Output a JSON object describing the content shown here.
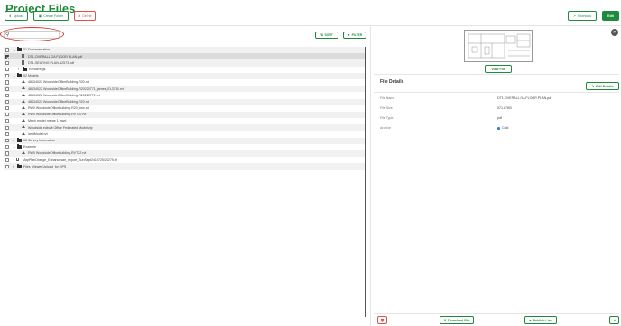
{
  "header": {
    "title": "Project Files",
    "upload_label": "Upload",
    "create_folder_label": "Create Folder",
    "delete_label": "Delete",
    "shortcuts_label": "Shortcuts",
    "edit_label": "Edit"
  },
  "search": {
    "placeholder": "",
    "value": ""
  },
  "toolbar": {
    "sort_label": "SORT",
    "filter_label": "FILTER"
  },
  "tree": [
    {
      "label": "01 Documentation",
      "type": "folder",
      "level": 0,
      "expanded": true,
      "checked": false
    },
    {
      "label": "DT1-OVERALL GA FLOOR PLAN.pdf",
      "type": "file",
      "level": 1,
      "checked": true,
      "selected": true
    },
    {
      "label": "DT1-SEATING PLAN-12573.pdf",
      "type": "file",
      "level": 1,
      "checked": false
    },
    {
      "label": "Renderings",
      "type": "folder",
      "level": 1,
      "expanded": false,
      "checked": false
    },
    {
      "label": "02 Models",
      "type": "folder",
      "level": 0,
      "expanded": true,
      "checked": false
    },
    {
      "label": "48634022 WoodsideOfficeBuilding-R20.rvt",
      "type": "model",
      "level": 1,
      "checked": false
    },
    {
      "label": "48634022 WoodsideOfficeBuilding-R20220771_james_EL3740.rvt",
      "type": "model",
      "level": 1,
      "checked": false
    },
    {
      "label": "48634022 WoodsideOfficeBuilding-R20220771.rvt",
      "type": "model",
      "level": 1,
      "checked": false
    },
    {
      "label": "48634022 WoodsideOfficeBuilding-R20.rvt",
      "type": "model",
      "level": 1,
      "checked": false
    },
    {
      "label": "RW0 WoodsideOfficeBuilding-R20_ano.rvt",
      "type": "model",
      "level": 1,
      "checked": false
    },
    {
      "label": "RW0 WoodsideOfficeBuilding-RVT20.rvt",
      "type": "model",
      "level": 1,
      "checked": false
    },
    {
      "label": "Mesh model merge 1 .nwd",
      "type": "model",
      "level": 1,
      "checked": false
    },
    {
      "label": "Woodside edbuilt Office Federated Model.zip",
      "type": "model",
      "level": 1,
      "checked": false
    },
    {
      "label": "landModel.rvt",
      "type": "model",
      "level": 1,
      "checked": false
    },
    {
      "label": "03 Survey Information",
      "type": "folder",
      "level": 0,
      "expanded": false,
      "checked": false
    },
    {
      "label": "Example",
      "type": "folder",
      "level": 0,
      "expanded": true,
      "checked": false
    },
    {
      "label": "RW0 WoodsideOfficeBuilding-RVT22.rvt",
      "type": "model",
      "level": 1,
      "checked": false
    },
    {
      "label": "MapPlanOrange_Enhancesan_export_SunSept2419725/24275.tif",
      "type": "file",
      "level": 0,
      "checked": false
    },
    {
      "label": "Files_Viewer Upload_by OPS",
      "type": "folder",
      "level": 0,
      "expanded": false,
      "checked": false
    }
  ],
  "preview": {
    "view_file_label": "View File"
  },
  "details": {
    "title": "File Details",
    "edit_label": "Edit Details",
    "rows": [
      {
        "key": "File Name",
        "value": "DT1-OVERALL GA FLOOR PLAN.pdf"
      },
      {
        "key": "File Size",
        "value": "571.87KB"
      },
      {
        "key": "File Type",
        "value": "pdf"
      },
      {
        "key": "Archive",
        "value": "Cold"
      }
    ]
  },
  "footer": {
    "download_label": "Download File",
    "publish_label": "Publish Link"
  },
  "colors": {
    "accent": "#1e8a3c",
    "danger": "#d9534f",
    "highlight": "#d43b33"
  }
}
